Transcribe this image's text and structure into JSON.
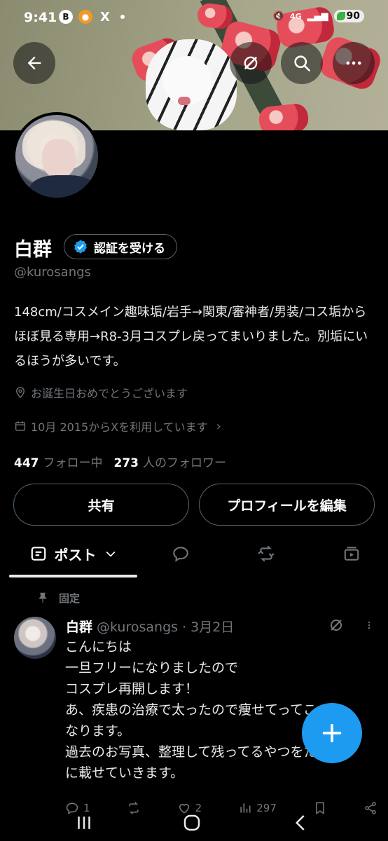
{
  "status_bar": {
    "time": "9:41",
    "app_icons": [
      "B",
      "X"
    ],
    "network": "4G",
    "battery": "90"
  },
  "header": {
    "back_icon": "back-arrow-icon",
    "grok_icon": "grok-icon",
    "search_icon": "search-icon",
    "more_icon": "more-icon"
  },
  "profile": {
    "display_name": "白群",
    "verify_label": "認証を受ける",
    "handle": "@kurosangs",
    "bio": "148cm/コスメイン趣味垢/岩手→関東/審神者/男装/コス垢からほぼ見る専用→R8-3月コスプレ戻ってまいりました。別垢にいるほうが多いです。",
    "location": "お誕生日おめでとうございます",
    "joined": "10月 2015からXを利用しています",
    "following_count": "447",
    "following_label": "フォロー中",
    "followers_count": "273",
    "followers_label": "人のフォロワー",
    "share_label": "共有",
    "edit_label": "プロフィールを編集"
  },
  "tabs": {
    "posts_label": "ポスト"
  },
  "pinned_post": {
    "pinned_label": "固定",
    "name": "白群",
    "handle": "@kurosangs",
    "date": "· 3月2日",
    "lines": [
      "こんにちは",
      "一旦フリーになりましたので",
      "コスプレ再開します！",
      "あ、疾患の治療で太ったので痩せて",
      "なります。",
      "過去のお写真、整理して残ってるや",
      "に載せていきます。"
    ],
    "line_tails": [
      "",
      "",
      "",
      "ってこ",
      "",
      "つをたま",
      ""
    ],
    "replies": "1",
    "likes": "2",
    "views": "297"
  },
  "colors": {
    "accent": "#1d9bf0",
    "muted": "#71767b",
    "border": "#536471"
  }
}
